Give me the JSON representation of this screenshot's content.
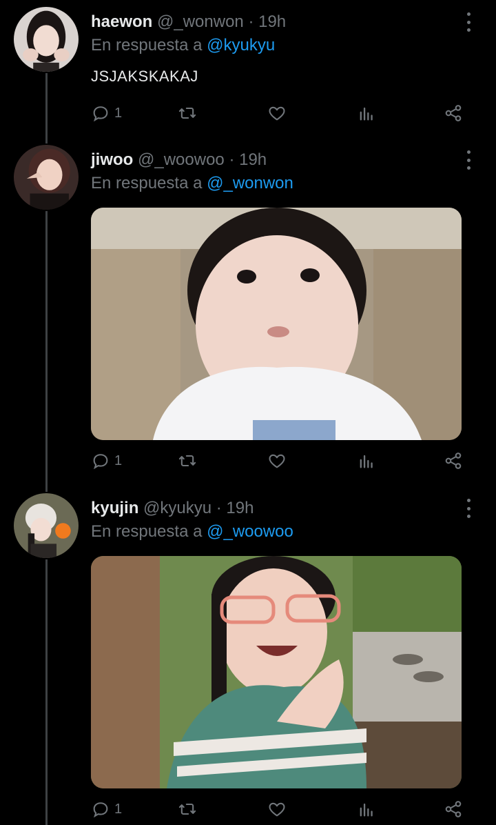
{
  "tweets": [
    {
      "name": "haewon",
      "handle": "@_wonwon",
      "time": "· 19h",
      "reply_prefix": "En respuesta a",
      "reply_to": "@kyukyu",
      "text": "JSJAKSKAKAJ",
      "reply_count": "1",
      "has_media": false,
      "media_desc": ""
    },
    {
      "name": "jiwoo",
      "handle": "@_woowoo",
      "time": "· 19h",
      "reply_prefix": "En respuesta a",
      "reply_to": "@_wonwon",
      "text": "",
      "reply_count": "1",
      "has_media": true,
      "media_desc": "Photo of a baby in a white shirt"
    },
    {
      "name": "kyujin",
      "handle": "@kyukyu",
      "time": "· 19h",
      "reply_prefix": "En respuesta a",
      "reply_to": "@_woowoo",
      "text": "",
      "reply_count": "1",
      "has_media": true,
      "media_desc": "Photo of a smiling child with glasses"
    }
  ],
  "colors": {
    "background": "#000000",
    "text_primary": "#e7e9ea",
    "text_secondary": "#71767b",
    "accent": "#1d9bf0",
    "thread_line": "#3e4144"
  },
  "icons": [
    "reply-icon",
    "retweet-icon",
    "like-icon",
    "analytics-icon",
    "share-icon",
    "more-options-icon"
  ]
}
